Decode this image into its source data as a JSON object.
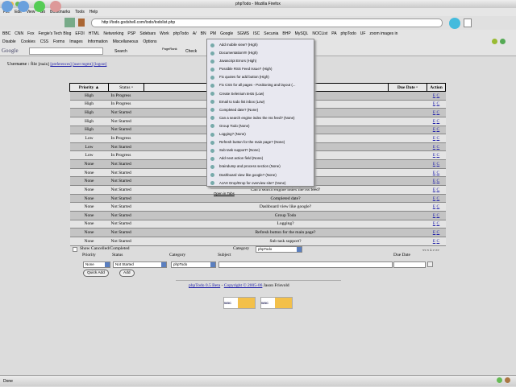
{
  "window": {
    "title": "phpTodo - Mozilla Firefox"
  },
  "menubar": [
    "File",
    "Edit",
    "View",
    "Go",
    "Bookmarks",
    "Tools",
    "Help"
  ],
  "url": "http://todo.godshell.com/todo/todolist.php",
  "bookmarks": [
    "BBC",
    "CNN",
    "Fox",
    "Fergie's Tech Blog",
    "EFDI",
    "HTML",
    "Networking",
    "PSP",
    "Sidebars",
    "Work",
    "phpTodo",
    "A/",
    "BN",
    "PM",
    "Google",
    "SGMS",
    "ISC",
    "Secunia",
    "BHP",
    "MySQL",
    "NOCList",
    "PA",
    "phpTodo",
    "UF",
    "zoom images in"
  ],
  "devbar": [
    "Disable",
    "Cookies",
    "CSS",
    "Forms",
    "Images",
    "Information",
    "Miscellaneous",
    "Options"
  ],
  "googlebar": {
    "logo": "Google",
    "search": "Search",
    "pagerank": "PageRank",
    "check": "Check"
  },
  "user": {
    "label": "Username : fiiz",
    "main": "[main]",
    "prefs": "[preferences]",
    "usermgmt": "[user mgmt]",
    "logout": "[logout]"
  },
  "table": {
    "headers": {
      "priority": "Priority",
      "status": "Status",
      "due": "Due Date",
      "action": "Action"
    },
    "rows": [
      {
        "priority": "High",
        "status": "In Progress",
        "subject": ""
      },
      {
        "priority": "High",
        "status": "In Progress",
        "subject": ""
      },
      {
        "priority": "High",
        "status": "Not Started",
        "subject": ""
      },
      {
        "priority": "High",
        "status": "Not Started",
        "subject": ""
      },
      {
        "priority": "High",
        "status": "Not Started",
        "subject": ""
      },
      {
        "priority": "Low",
        "status": "In Progress",
        "subject": ""
      },
      {
        "priority": "Low",
        "status": "Not Started",
        "subject": ""
      },
      {
        "priority": "Low",
        "status": "In Progress",
        "subject": "t"
      },
      {
        "priority": "None",
        "status": "Not Started",
        "subject": ""
      },
      {
        "priority": "None",
        "status": "Not Started",
        "subject": ""
      },
      {
        "priority": "None",
        "status": "Not Started",
        "subject": ""
      },
      {
        "priority": "None",
        "status": "Not Started",
        "subject": "Can a search engine index the rss feed?"
      },
      {
        "priority": "None",
        "status": "Not Started",
        "subject": "Completed date?"
      },
      {
        "priority": "None",
        "status": "Not Started",
        "subject": "Dashboard view like google?"
      },
      {
        "priority": "None",
        "status": "Not Started",
        "subject": "Group Todo"
      },
      {
        "priority": "None",
        "status": "Not Started",
        "subject": "Logging?"
      },
      {
        "priority": "None",
        "status": "Not Started",
        "subject": "Refresh button for the main page?"
      },
      {
        "priority": "None",
        "status": "Not Started",
        "subject": "Sub task support?"
      }
    ],
    "edit": "E",
    "complete": "C"
  },
  "bookmark_menu": [
    "Add mobile view? (High)",
    "Documentation!!!! (High)",
    "Javascript Errors (High)",
    "Possible RSS Feed Issue? (High)",
    "Fix quotes for add button (High)",
    "Fix CSS for all pages - Positioning and layout (...",
    "Create Selenium tests (Low)",
    "Email to todo list inbox (Low)",
    "Completed date? (None)",
    "Can a search engine index the rss feed? (None)",
    "Group Todo (None)",
    "Logging? (None)",
    "Refresh button for the main page? (None)",
    "Sub task support? (None)",
    "Add next action field (None)",
    "braindump and process section (None)",
    "Dashboard view like google? (None)",
    "AJAX Drop/Drop for overview site? (None)"
  ],
  "open_in_tabs": "Open in Tabs",
  "filters": {
    "show_cancelled": "Show Cancelled/Completed",
    "category_label": "Category",
    "category": "phpTodo",
    "pager": "<< < 1 > >>"
  },
  "add": {
    "priority_label": "Priority",
    "status_label": "Status",
    "category_label": "Category",
    "subject_label": "Subject",
    "due_label": "Due Date",
    "priority": "None",
    "status": "Not Started",
    "category": "phpTodo",
    "subject": "",
    "quick_add": "Quick Add",
    "add": "Add"
  },
  "footer": {
    "app": "phpTodo 0.5 Beta",
    "sep": "-",
    "copyright": "Copyright © 2005-06",
    "author": "Jason Frisvold",
    "badge1": "W3C XHTML 1.0",
    "badge2": "W3C CSS"
  },
  "status": "Done"
}
